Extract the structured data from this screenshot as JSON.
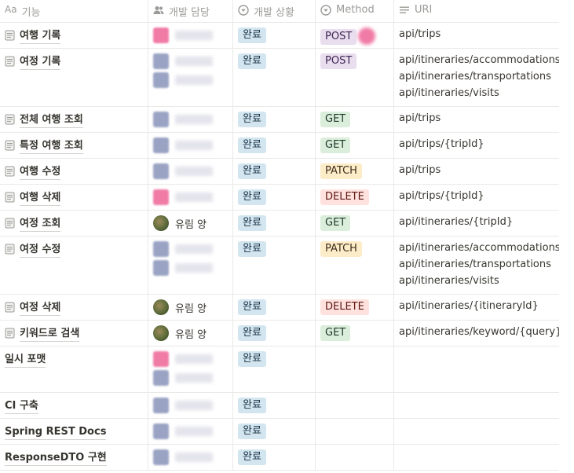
{
  "headers": [
    {
      "label": "기능",
      "icon": "title-aa-icon",
      "icon_text": "Aa"
    },
    {
      "label": "개발 담당",
      "icon": "people-icon"
    },
    {
      "label": "개발 상황",
      "icon": "select-circle-icon"
    },
    {
      "label": "Method",
      "icon": "select-circle-icon"
    },
    {
      "label": "URI",
      "icon": "text-lines-icon"
    }
  ],
  "rows": [
    {
      "title": "여행 기록",
      "has_page_icon": true,
      "assignees": [
        "blur-pink"
      ],
      "status": "완료",
      "method": "POST",
      "method_marker": true,
      "uri": [
        "api/trips"
      ]
    },
    {
      "title": "여정 기록",
      "has_page_icon": true,
      "assignees": [
        "blur",
        "blur"
      ],
      "status": "완료",
      "method": "POST",
      "uri": [
        "api/itineraries/accommodations",
        "api/itineraries/transportations",
        "api/itineraries/visits"
      ]
    },
    {
      "title": "전체 여행 조회",
      "has_page_icon": true,
      "assignees": [
        "blur"
      ],
      "status": "완료",
      "method": "GET",
      "uri": [
        "api/trips"
      ]
    },
    {
      "title": "특정 여행 조회",
      "has_page_icon": true,
      "assignees": [
        "blur"
      ],
      "status": "완료",
      "method": "GET",
      "uri": [
        "api/trips/{tripId}"
      ]
    },
    {
      "title": "여행 수정",
      "has_page_icon": true,
      "assignees": [
        "blur"
      ],
      "status": "완료",
      "method": "PATCH",
      "uri": [
        "api/trips"
      ]
    },
    {
      "title": "여행 삭제",
      "has_page_icon": true,
      "assignees": [
        "blur-pink"
      ],
      "status": "완료",
      "method": "DELETE",
      "uri": [
        "api/trips/{tripId}"
      ]
    },
    {
      "title": "여정 조회",
      "has_page_icon": true,
      "assignees": [
        "유림 양"
      ],
      "status": "완료",
      "method": "GET",
      "uri": [
        "api/itineraries/{tripId}"
      ]
    },
    {
      "title": "여정 수정",
      "has_page_icon": true,
      "assignees": [
        "blur",
        "blur"
      ],
      "status": "완료",
      "method": "PATCH",
      "uri": [
        "api/itineraries/accommodations",
        "api/itineraries/transportations",
        "api/itineraries/visits"
      ]
    },
    {
      "title": "여정 삭제",
      "has_page_icon": true,
      "assignees": [
        "유림 양"
      ],
      "status": "완료",
      "method": "DELETE",
      "uri": [
        "api/itineraries/{itineraryId}"
      ]
    },
    {
      "title": "키워드로 검색",
      "has_page_icon": true,
      "assignees": [
        "유림 양"
      ],
      "status": "완료",
      "method": "GET",
      "uri": [
        "api/itineraries/keyword/{query}"
      ]
    },
    {
      "title": "일시 포맷",
      "has_page_icon": false,
      "assignees": [
        "blur-pink",
        "blur"
      ],
      "status": "완료",
      "method": "",
      "uri": []
    },
    {
      "title": "CI 구축",
      "has_page_icon": false,
      "assignees": [
        "blur"
      ],
      "status": "완료",
      "method": "",
      "uri": []
    },
    {
      "title": "Spring REST Docs",
      "has_page_icon": false,
      "assignees": [
        "blur"
      ],
      "status": "완료",
      "method": "",
      "uri": []
    },
    {
      "title": "ResponseDTO 구현",
      "has_page_icon": false,
      "assignees": [
        "blur"
      ],
      "status": "완료",
      "method": "",
      "uri": []
    }
  ],
  "colors": {
    "status_done_bg": "#d3e5ef",
    "POST": "#e8deee",
    "GET": "#dbeddb",
    "PATCH": "#fdecc8",
    "DELETE": "#ffe2dd",
    "border": "#e9e9e7",
    "header_text": "#9b9a97"
  }
}
